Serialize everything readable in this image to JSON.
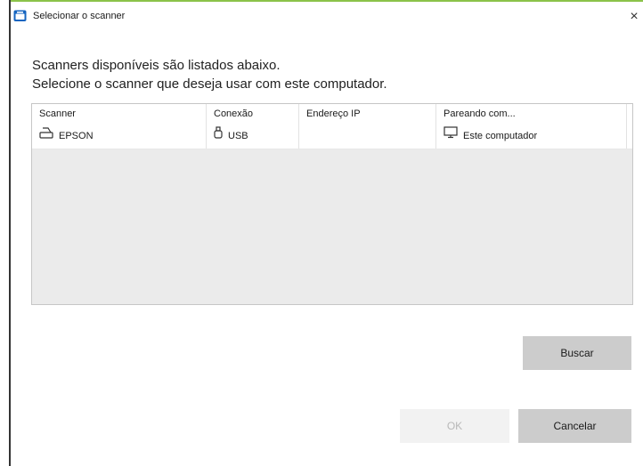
{
  "window": {
    "title": "Selecionar o scanner",
    "close_glyph": "×",
    "accent_color": "#8bc34a",
    "icon": "scanner-app-icon"
  },
  "instructions": {
    "line1": "Scanners disponíveis são listados abaixo.",
    "line2": "Selecione o scanner que deseja usar com este computador."
  },
  "table": {
    "headers": [
      "Scanner",
      "Conexão",
      "Endereço IP",
      "Pareando com..."
    ],
    "rows": [
      {
        "scanner": "EPSON",
        "scanner_icon": "printer-icon",
        "connection": "USB",
        "connection_icon": "usb-icon",
        "ip": "",
        "pairing": "Este computador",
        "pairing_icon": "monitor-icon"
      }
    ]
  },
  "buttons": {
    "search": "Buscar",
    "ok": "OK",
    "cancel": "Cancelar"
  }
}
